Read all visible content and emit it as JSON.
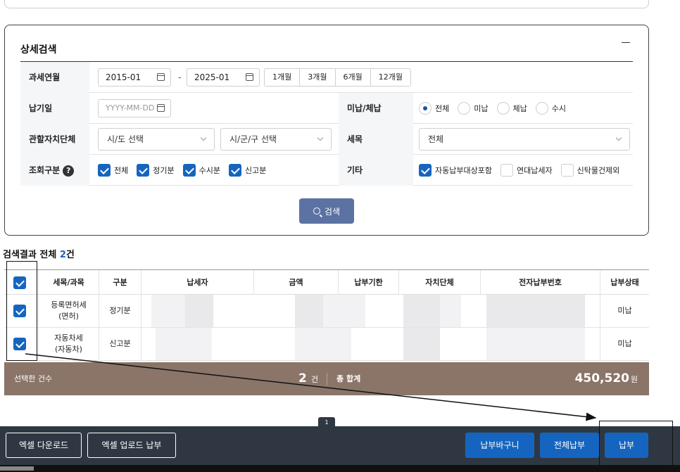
{
  "detail_search": {
    "title": "상세검색",
    "period": {
      "label": "과세연월",
      "start": "2015-01",
      "end": "2025-01",
      "separator": "-",
      "quick": [
        "1개월",
        "3개월",
        "6개월",
        "12개월"
      ]
    },
    "due_date": {
      "label": "납기일",
      "placeholder": "YYYY-MM-DD"
    },
    "arrears": {
      "label": "미납/체납",
      "options": [
        "전체",
        "미납",
        "체납",
        "수시"
      ],
      "selected": "전체"
    },
    "authority": {
      "label": "관할자치단체",
      "sido": "시/도 선택",
      "sigungu": "시/군/구 선택"
    },
    "tax_item": {
      "label": "세목",
      "value": "전체"
    },
    "query_type": {
      "label": "조회구분",
      "help": "?",
      "options": [
        {
          "label": "전체",
          "checked": true
        },
        {
          "label": "정기분",
          "checked": true
        },
        {
          "label": "수시분",
          "checked": true
        },
        {
          "label": "신고분",
          "checked": true
        }
      ]
    },
    "etc": {
      "label": "기타",
      "options": [
        {
          "label": "자동납부대상포함",
          "checked": true
        },
        {
          "label": "연대납세자",
          "checked": false
        },
        {
          "label": "신탁물건제외",
          "checked": false
        }
      ]
    },
    "search_button": "검색"
  },
  "results": {
    "title_prefix": "검색결과 전체 ",
    "count": "2",
    "title_suffix": "건",
    "columns": [
      "세목/과목",
      "구분",
      "납세자",
      "금액",
      "납부기한",
      "자치단체",
      "전자납부번호",
      "납부상태"
    ],
    "rows": [
      {
        "tax_line1": "등록면허세",
        "tax_line2": "(면허)",
        "type": "정기분",
        "status": "미납",
        "checked": true
      },
      {
        "tax_line1": "자동차세",
        "tax_line2": "(자동차)",
        "type": "신고분",
        "status": "미납",
        "checked": true
      }
    ]
  },
  "totals": {
    "selected_label": "선택한 건수",
    "selected_count": "2",
    "count_unit": "건",
    "sum_label": "총 합계",
    "sum_amount": "450,520",
    "sum_unit": "원"
  },
  "page_number": "1",
  "bottom_bar": {
    "excel_download": "엑셀 다운로드",
    "excel_upload_pay": "엑셀 업로드 납부",
    "cart": "납부바구니",
    "pay_all": "전체납부",
    "pay": "납부"
  },
  "colors": {
    "primary": "#1565c0",
    "search_button": "#5b72a3",
    "total_bar": "#8a7568",
    "bottom_bar": "#2f3842"
  }
}
